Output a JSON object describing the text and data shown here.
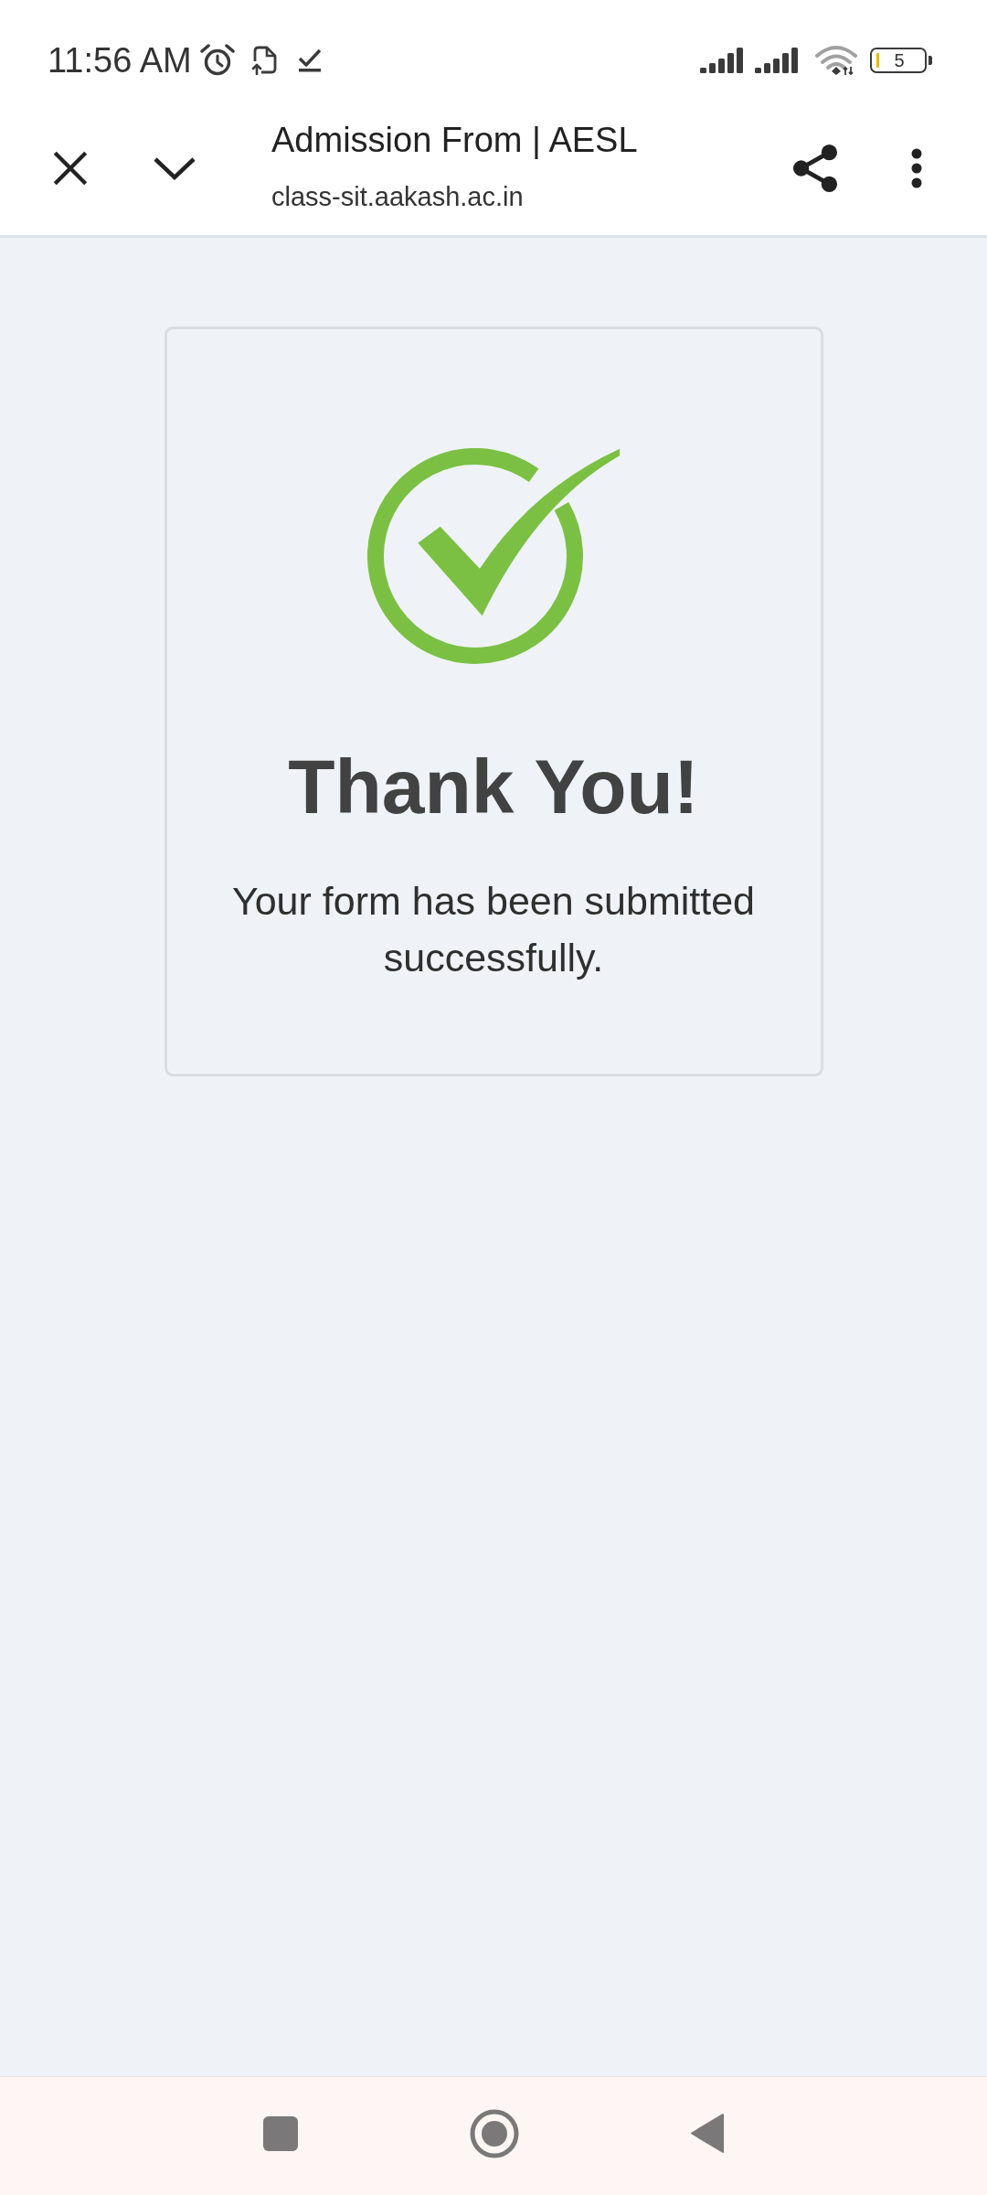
{
  "status_bar": {
    "time": "11:56 AM",
    "battery": "5"
  },
  "toolbar": {
    "title": "Admission From | AESL",
    "url": "class-sit.aakash.ac.in"
  },
  "confirmation": {
    "heading": "Thank You!",
    "message": "Your form has been submitted successfully."
  }
}
